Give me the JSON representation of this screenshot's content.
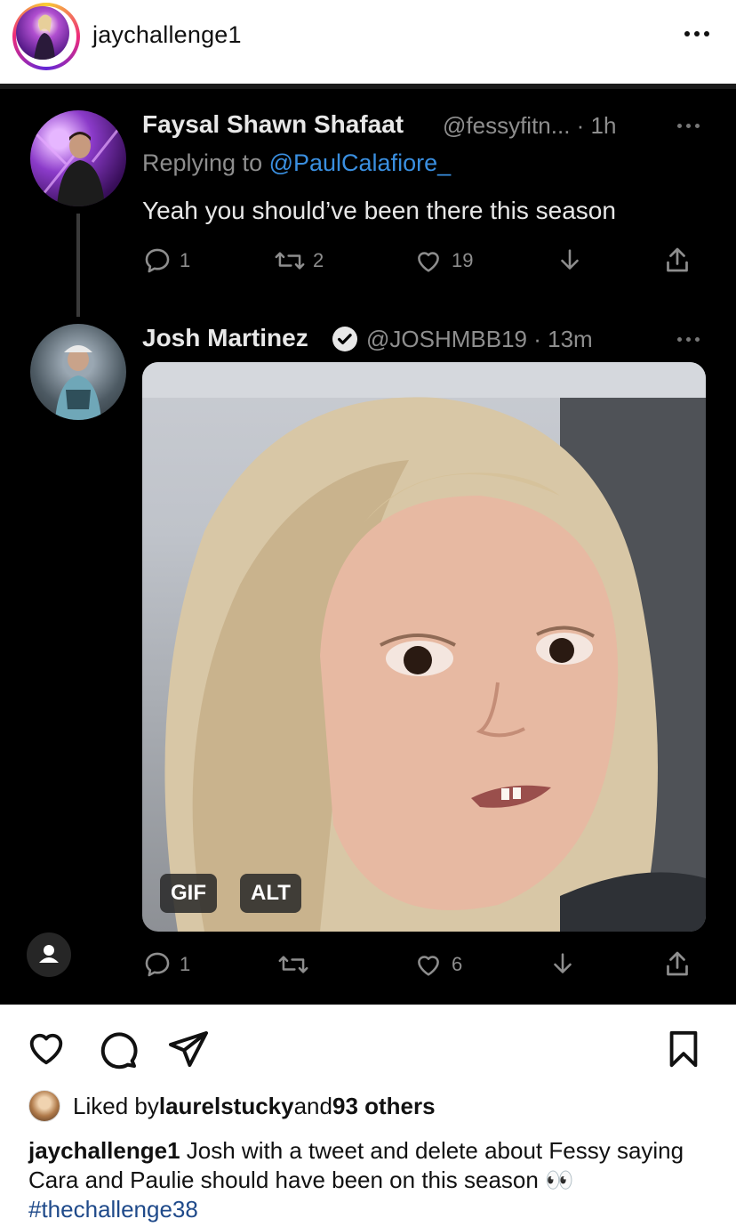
{
  "header": {
    "username": "jaychallenge1"
  },
  "tweet1": {
    "name": "Faysal Shawn Shafaat",
    "handle_time": "@fessyfitn... · 1h",
    "replying_prefix": "Replying to ",
    "replying_to": "@PaulCalafiore_",
    "text": "Yeah you should’ve been there this season",
    "reply_count": "1",
    "retweet_count": "2",
    "like_count": "19"
  },
  "tweet2": {
    "name": "Josh Martinez",
    "handle_time": "@JOSHMBB19 · 13m",
    "gif_badge": "GIF",
    "alt_badge": "ALT",
    "reply_count": "1",
    "like_count": "6"
  },
  "post": {
    "liked_prefix": "Liked by ",
    "liked_user": "laurelstucky",
    "liked_mid": " and ",
    "liked_others": "93 others",
    "caption_user": "jaychallenge1",
    "caption_text": " Josh with a tweet and delete about Fessy saying Cara and Paulie should have been on this season 👀 ",
    "hashtag": "#thechallenge38"
  },
  "colors": {
    "mention": "#3a8fe0",
    "hashtag": "#1f4a8a",
    "tweet_bg": "#000000"
  },
  "icons": [
    "heart-icon",
    "comment-icon",
    "share-icon",
    "bookmark-icon",
    "more-icon",
    "reply-icon",
    "retweet-icon",
    "like-icon",
    "bookmark-down-icon",
    "upload-icon",
    "verified-icon",
    "person-icon"
  ]
}
